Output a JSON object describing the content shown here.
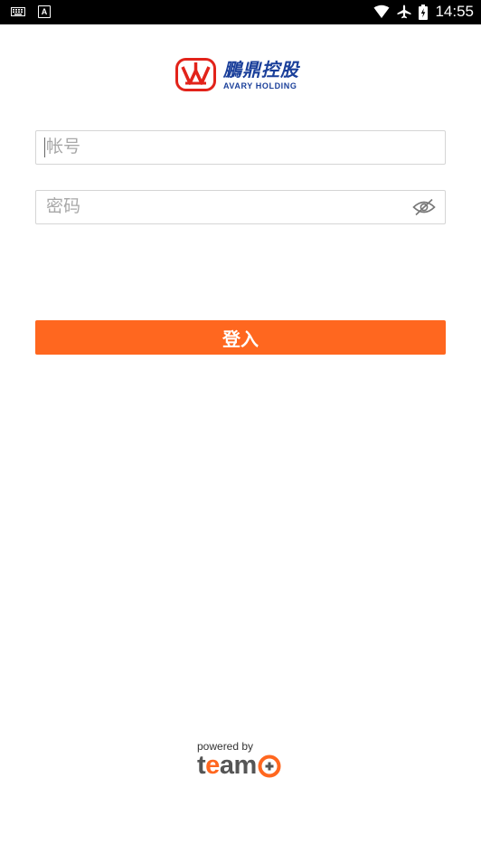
{
  "status_bar": {
    "time": "14:55",
    "left_icons": [
      "keyboard-icon",
      "a-icon"
    ],
    "a_icon_letter": "A",
    "right_icons": [
      "wifi-icon",
      "airplane-icon",
      "battery-icon"
    ]
  },
  "logo": {
    "chinese_name": "鵬鼎控股",
    "english_name": "AVARY HOLDING",
    "brand_red": "#e2231a",
    "brand_blue": "#1a3f9a"
  },
  "form": {
    "account_placeholder": "帐号",
    "password_placeholder": "密码",
    "password_visibility_icon": "eye-off-icon",
    "login_label": "登入",
    "accent_color": "#ff671f"
  },
  "footer": {
    "powered_by": "powered by",
    "brand": "teamO"
  }
}
